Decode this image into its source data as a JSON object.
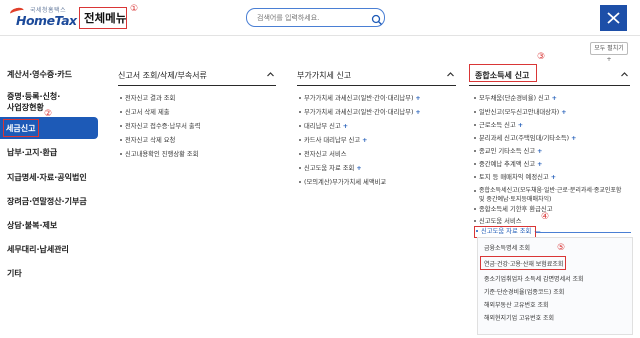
{
  "header": {
    "logo_small": "국세청홈택스",
    "logo_big": "HomeTax",
    "menu_title": "전체메뉴",
    "search_placeholder": "검색어를 입력하세요.",
    "expand_all_label": "모두 펼치기 +"
  },
  "markers": [
    "①",
    "②",
    "③",
    "④",
    "⑤"
  ],
  "sidebar": {
    "items": [
      "계산서·영수증·카드",
      "증명·등록·신청·",
      "사업장현황",
      "세금신고",
      "납부·고지·환급",
      "지급명세·자료·공익법인",
      "장려금·연말정산·기부금",
      "상담·불복·제보",
      "세무대리·납세관리",
      "기타"
    ],
    "active_index": 3
  },
  "columns": [
    {
      "title": "신고서 조회/삭제/부속서류",
      "items": [
        {
          "label": "전자신고 결과 조회",
          "plus": false
        },
        {
          "label": "신고서 삭제 제출",
          "plus": false
        },
        {
          "label": "전자신고 접수증·납부서 출력",
          "plus": false
        },
        {
          "label": "전자신고 삭제 요청",
          "plus": false
        },
        {
          "label": "신고내용확인 진행상황 조회",
          "plus": false
        }
      ]
    },
    {
      "title": "부가가치세 신고",
      "items": [
        {
          "label": "부가가치세 과세신고(일반·간이·대리납부)",
          "plus": true
        },
        {
          "label": "부가가치세 과세신고(일반·간이·대리납부)",
          "plus": true
        },
        {
          "label": "대리납부 신고",
          "plus": true
        },
        {
          "label": "카드사 대리납부 신고",
          "plus": true
        },
        {
          "label": "전자신고 서비스",
          "plus": false
        },
        {
          "label": "신고도움 자료 조회",
          "plus": true
        },
        {
          "label": "(모의계산)부가가치세 세액비교",
          "plus": false
        }
      ]
    },
    {
      "title": "종합소득세 신고",
      "items": [
        {
          "label": "모두채움(단순경비율) 신고",
          "plus": true
        },
        {
          "label": "일반신고(모두신고안내대상자)",
          "plus": true
        },
        {
          "label": "근로소득 신고",
          "plus": true
        },
        {
          "label": "분리과세 신고(주택임대/기타소득)",
          "plus": true
        },
        {
          "label": "종교인 기타소득 신고",
          "plus": true
        },
        {
          "label": "중간예납 추계액 신고",
          "plus": true
        },
        {
          "label": "토지 등 매매차익 예정신고",
          "plus": true
        },
        {
          "label": "종합소득세신고(모두채움·일반·근로·분리과세·종교인포함",
          "plus": false
        },
        {
          "label": "및 중간예납·토지등매매차익)",
          "plus": false
        },
        {
          "label": "종합소득세 기한후 환급신고",
          "plus": false
        },
        {
          "label": "신고도움 서비스",
          "plus": false
        },
        {
          "label": "신고도움 자료 조회",
          "plus": false
        }
      ],
      "sub_items": [
        "금융소득명세 조회",
        "연금·건강·고용·산재 보험료조회",
        "중소기업취업자 소득세 감면명세서 조회",
        "기준·단순경비율(업종코드) 조회",
        "해외부동산 고유번호 조회",
        "해외현지기업 고유번호 조회"
      ]
    }
  ]
}
